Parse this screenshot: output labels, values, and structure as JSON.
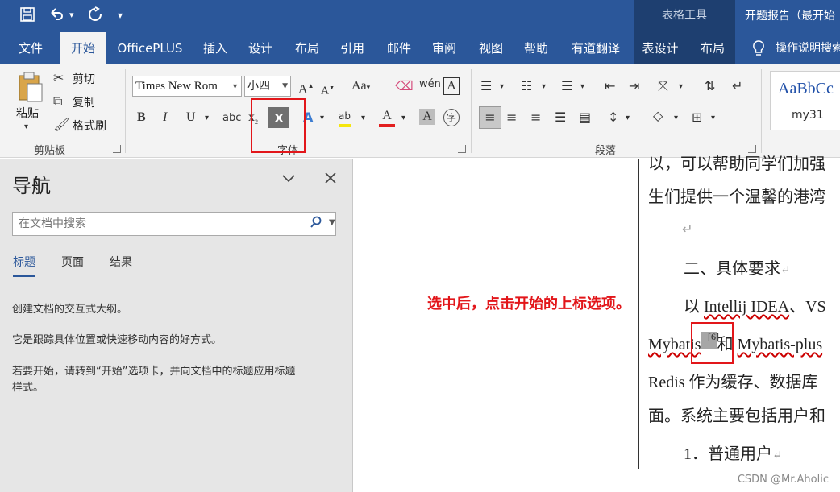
{
  "titlebar": {
    "save_icon": "save-icon",
    "undo_icon": "undo-icon",
    "redo_icon": "redo-icon",
    "customize_icon": "customize-qat-icon",
    "context_group": "表格工具",
    "doc_title": "开题报告（最开始"
  },
  "tabs": {
    "file": "文件",
    "home": "开始",
    "officeplus": "OfficePLUS",
    "insert": "插入",
    "design": "设计",
    "layout": "布局",
    "references": "引用",
    "mailings": "邮件",
    "review": "审阅",
    "view": "视图",
    "help": "帮助",
    "youdao": "有道翻译",
    "table_design": "表设计",
    "table_layout": "布局",
    "tell_me": "操作说明搜索"
  },
  "ribbon": {
    "clipboard": {
      "paste": "粘贴",
      "cut": "剪切",
      "copy": "复制",
      "format_painter": "格式刷",
      "group_label": "剪贴板"
    },
    "font": {
      "font_name": "Times New Rom",
      "font_size": "小四",
      "group_label": "字体"
    },
    "paragraph": {
      "group_label": "段落"
    },
    "styles": {
      "sample": "AaBbCc",
      "name": "my31"
    }
  },
  "nav": {
    "title": "导航",
    "search_placeholder": "在文档中搜索",
    "tabs": [
      "标题",
      "页面",
      "结果"
    ],
    "help_1": "创建文档的交互式大纲。",
    "help_2": "它是跟踪具体位置或快速移动内容的好方式。",
    "help_3a": "若要开始，请转到“开始”选项卡，并向文档中的标题应用标题",
    "help_3b": "样式。"
  },
  "document": {
    "line1": "以，可以帮助同学们加强",
    "line2": "生们提供一个温馨的港湾",
    "heading": "二、具体要求",
    "line4_a": "以 ",
    "line4_b": "Intellij IDEA",
    "line4_c": "、VS",
    "line5_a": "Mybatis",
    "line5_sup": "[6]",
    "line5_b": "和 ",
    "line5_c": "Mybatis-plus",
    "line6": "Redis 作为缓存、数据库",
    "line7": "面。系统主要包括用户和",
    "line8": "1．普通用户"
  },
  "annotation": "选中后，点击开始的上标选项。",
  "watermark": "CSDN @Mr.Aholic",
  "colors": {
    "ribbon_blue": "#2b579a",
    "context_blue": "#1e3f70",
    "annotation_red": "#e2161a"
  }
}
